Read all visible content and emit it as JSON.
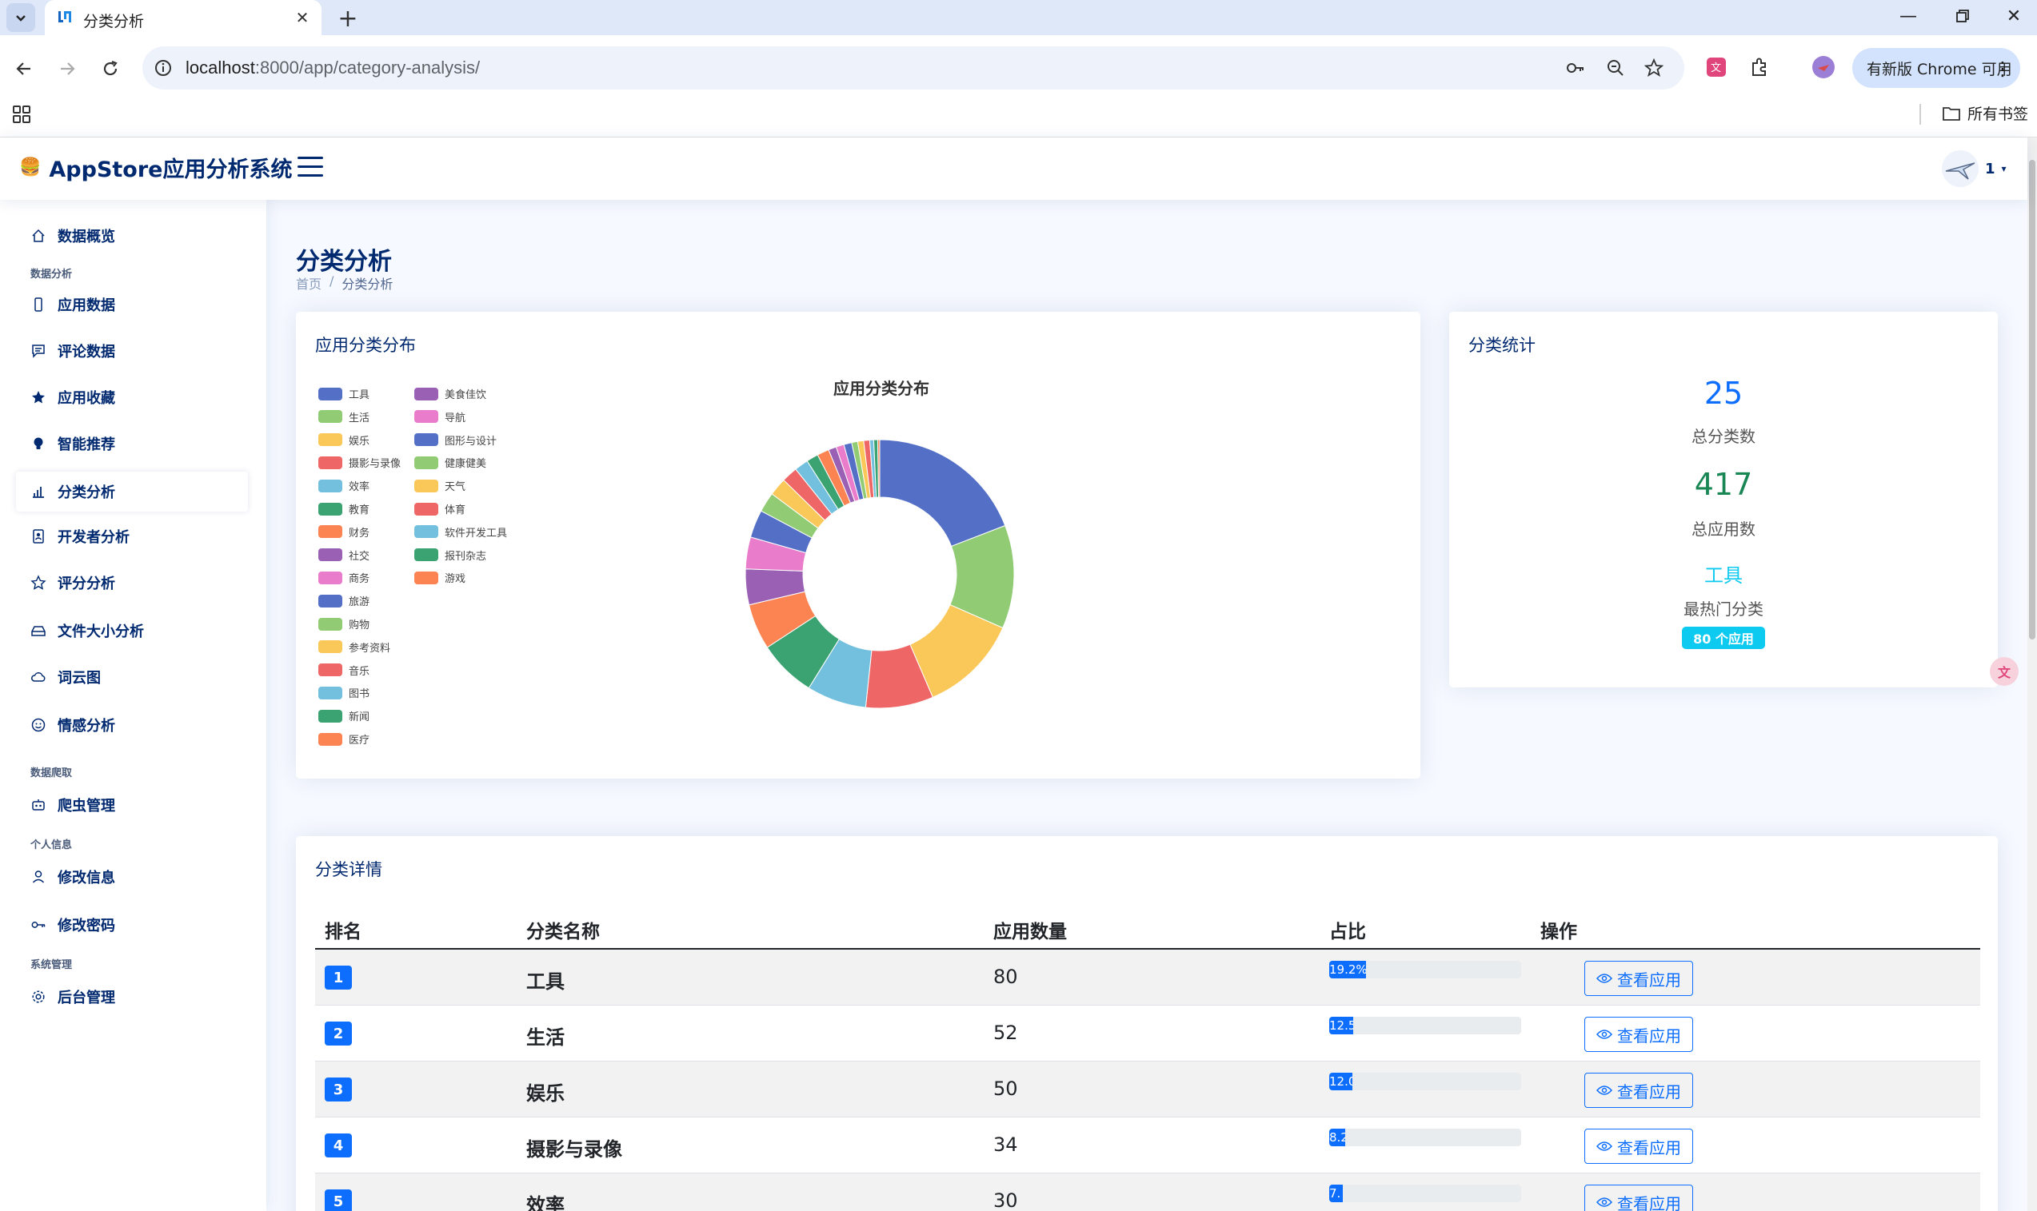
{
  "browser": {
    "tab_title": "分类分析",
    "url_host": "localhost",
    "url_rest": ":8000/app/category-analysis/",
    "update_label": "有新版 Chrome 可用",
    "bookmarks_label": "所有书签"
  },
  "header": {
    "app_title": "AppStore应用分析系统",
    "user": "1"
  },
  "sidebar": {
    "items": [
      {
        "label": "数据概览",
        "icon": "home-icon"
      },
      {
        "label": "应用数据",
        "icon": "phone-icon"
      },
      {
        "label": "评论数据",
        "icon": "chat-icon"
      },
      {
        "label": "应用收藏",
        "icon": "star-filled-icon"
      },
      {
        "label": "智能推荐",
        "icon": "bulb-icon"
      },
      {
        "label": "分类分析",
        "icon": "bar-chart-icon"
      },
      {
        "label": "开发者分析",
        "icon": "badge-icon"
      },
      {
        "label": "评分分析",
        "icon": "star-icon"
      },
      {
        "label": "文件大小分析",
        "icon": "drive-icon"
      },
      {
        "label": "词云图",
        "icon": "cloud-icon"
      },
      {
        "label": "情感分析",
        "icon": "smile-icon"
      },
      {
        "label": "爬虫管理",
        "icon": "robot-icon"
      },
      {
        "label": "修改信息",
        "icon": "person-icon"
      },
      {
        "label": "修改密码",
        "icon": "key-icon"
      },
      {
        "label": "后台管理",
        "icon": "gear-icon"
      }
    ],
    "headings": [
      "数据分析",
      "数据爬取",
      "个人信息",
      "系统管理"
    ]
  },
  "page": {
    "title": "分类分析",
    "breadcrumb_home": "首页",
    "breadcrumb_sep": "/",
    "breadcrumb_current": "分类分析"
  },
  "dist_card": {
    "title": "应用分类分布"
  },
  "stats_card": {
    "title": "分类统计",
    "total_categories": "25",
    "total_categories_label": "总分类数",
    "total_apps": "417",
    "total_apps_label": "总应用数",
    "hot_category": "工具",
    "hot_category_label": "最热门分类",
    "hot_badge": "80 个应用"
  },
  "chart_data": {
    "type": "pie",
    "title": "应用分类分布",
    "donut": true,
    "legend_position": "left",
    "categories": [
      "工具",
      "生活",
      "娱乐",
      "摄影与录像",
      "效率",
      "教育",
      "财务",
      "社交",
      "商务",
      "旅游",
      "购物",
      "参考资料",
      "音乐",
      "图书",
      "新闻",
      "医疗",
      "美食佳饮",
      "导航",
      "图形与设计",
      "健康健美",
      "天气",
      "体育",
      "软件开发工具",
      "报刊杂志",
      "游戏"
    ],
    "values": [
      80,
      52,
      50,
      34,
      30,
      29,
      23,
      18,
      16,
      14,
      10,
      9,
      8,
      7,
      6,
      6,
      4,
      4,
      4,
      3,
      3,
      3,
      2,
      2,
      1
    ],
    "colors": [
      "#5470c6",
      "#91cc75",
      "#fac858",
      "#ee6666",
      "#73c0de",
      "#3ba272",
      "#fc8452",
      "#9a60b4",
      "#ea7ccc",
      "#5470c6",
      "#91cc75",
      "#fac858",
      "#ee6666",
      "#73c0de",
      "#3ba272",
      "#fc8452",
      "#9a60b4",
      "#ea7ccc",
      "#5470c6",
      "#91cc75",
      "#fac858",
      "#ee6666",
      "#73c0de",
      "#3ba272",
      "#fc8452"
    ]
  },
  "table": {
    "title": "分类详情",
    "headers": [
      "排名",
      "分类名称",
      "应用数量",
      "占比",
      "操作"
    ],
    "rows": [
      {
        "rank": "1",
        "name": "工具",
        "count": "80",
        "pct_label": "19.2%",
        "pct": 19.2,
        "action": "查看应用"
      },
      {
        "rank": "2",
        "name": "生活",
        "count": "52",
        "pct_label": "12.5",
        "pct": 12.5,
        "action": "查看应用"
      },
      {
        "rank": "3",
        "name": "娱乐",
        "count": "50",
        "pct_label": "12.0",
        "pct": 12.0,
        "action": "查看应用"
      },
      {
        "rank": "4",
        "name": "摄影与录像",
        "count": "34",
        "pct_label": "8.2",
        "pct": 8.2,
        "action": "查看应用"
      },
      {
        "rank": "5",
        "name": "效率",
        "count": "30",
        "pct_label": "7.",
        "pct": 7.2,
        "action": "查看应用"
      }
    ]
  }
}
